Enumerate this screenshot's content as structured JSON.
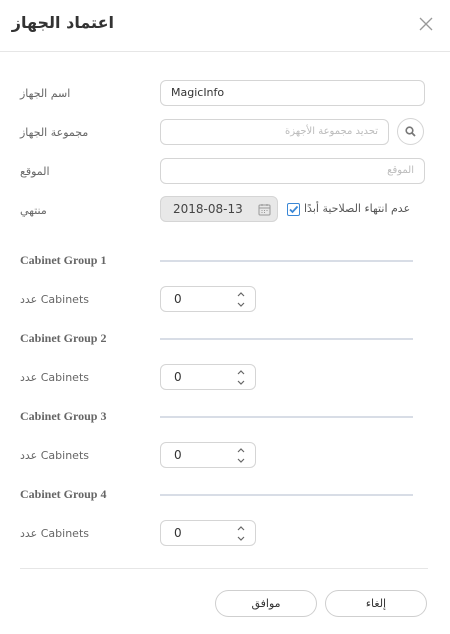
{
  "dialog": {
    "title": "اعتماد الجهاز"
  },
  "form": {
    "device_name_label": "اسم الجهاز",
    "device_name_value": "MagicInfo",
    "device_group_label": "مجموعة الجهاز",
    "device_group_placeholder": "تحديد مجموعة الأجهزة",
    "location_label": "الموقع",
    "location_placeholder": "الموقع",
    "expiry_label": "منتهي",
    "expiry_date": "2018-08-13",
    "never_expire_label": "عدم انتهاء الصلاحية أبدًا",
    "never_expire_checked": true
  },
  "cabinet_groups": [
    {
      "title": "Cabinet Group 1",
      "count_label": "عدد Cabinets",
      "count_value": "0"
    },
    {
      "title": "Cabinet Group 2",
      "count_label": "عدد Cabinets",
      "count_value": "0"
    },
    {
      "title": "Cabinet Group 3",
      "count_label": "عدد Cabinets",
      "count_value": "0"
    },
    {
      "title": "Cabinet Group 4",
      "count_label": "عدد Cabinets",
      "count_value": "0"
    }
  ],
  "footer": {
    "ok_label": "موافق",
    "cancel_label": "إلغاء"
  },
  "colors": {
    "accent": "#3a87d6",
    "disabled_bg": "#e8e8e8"
  }
}
